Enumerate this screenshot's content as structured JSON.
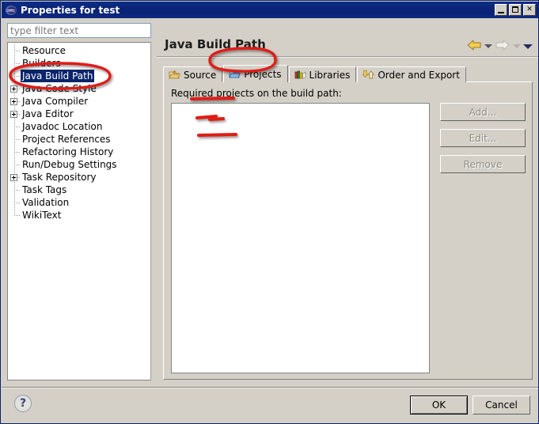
{
  "window": {
    "title": "Properties for test",
    "icon": "eclipse-icon",
    "controls": {
      "minimize": "minimize-button",
      "maximize": "maximize-button",
      "close": "✕"
    }
  },
  "sidebar": {
    "filter": {
      "value": "",
      "placeholder": "type filter text"
    },
    "items": [
      {
        "label": "Resource",
        "expandable": false,
        "selected": false
      },
      {
        "label": "Builders",
        "expandable": false,
        "selected": false
      },
      {
        "label": "Java Build Path",
        "expandable": false,
        "selected": true
      },
      {
        "label": "Java Code Style",
        "expandable": true,
        "selected": false
      },
      {
        "label": "Java Compiler",
        "expandable": true,
        "selected": false
      },
      {
        "label": "Java Editor",
        "expandable": true,
        "selected": false
      },
      {
        "label": "Javadoc Location",
        "expandable": false,
        "selected": false
      },
      {
        "label": "Project References",
        "expandable": false,
        "selected": false
      },
      {
        "label": "Refactoring History",
        "expandable": false,
        "selected": false
      },
      {
        "label": "Run/Debug Settings",
        "expandable": false,
        "selected": false
      },
      {
        "label": "Task Repository",
        "expandable": true,
        "selected": false
      },
      {
        "label": "Task Tags",
        "expandable": false,
        "selected": false
      },
      {
        "label": "Validation",
        "expandable": false,
        "selected": false
      },
      {
        "label": "WikiText",
        "expandable": false,
        "selected": false
      }
    ]
  },
  "page": {
    "title": "Java Build Path",
    "nav": {
      "back": "back-arrow",
      "back_menu": "back-dropdown",
      "forward": "forward-arrow",
      "forward_menu": "forward-dropdown",
      "view_menu": "view-menu"
    },
    "tabs": [
      {
        "label": "Source",
        "icon": "source-folder-icon",
        "active": false
      },
      {
        "label": "Projects",
        "icon": "projects-folder-icon",
        "active": true
      },
      {
        "label": "Libraries",
        "icon": "libraries-books-icon",
        "active": false
      },
      {
        "label": "Order and Export",
        "icon": "order-export-icon",
        "active": false
      }
    ],
    "panel": {
      "label": "Required projects on the build path:",
      "list_items": [],
      "buttons": [
        {
          "label": "Add...",
          "enabled": false
        },
        {
          "label": "Edit...",
          "enabled": false
        },
        {
          "label": "Remove",
          "enabled": false
        }
      ]
    }
  },
  "footer": {
    "help": "?",
    "ok": "OK",
    "cancel": "Cancel"
  },
  "annotations": {
    "color": "#e01b17",
    "ellipse_sidebar": "circle around Java Build Path",
    "ellipse_tab": "circle around Projects tab",
    "strike_1": "red line in list area",
    "strike_2": "red line in list area",
    "strike_3": "red line in list area"
  }
}
